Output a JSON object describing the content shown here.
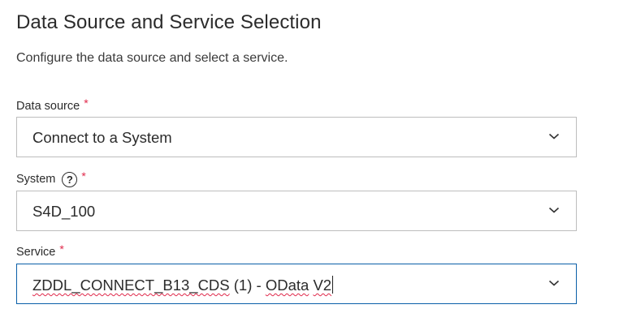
{
  "header": {
    "title": "Data Source and Service Selection",
    "subtitle": "Configure the data source and select a service."
  },
  "fields": {
    "data_source": {
      "label": "Data source",
      "required_marker": "*",
      "value": "Connect to a System"
    },
    "system": {
      "label": "System",
      "help_glyph": "?",
      "required_marker": "*",
      "value": "S4D_100"
    },
    "service": {
      "label": "Service",
      "required_marker": "*",
      "value_parts": [
        "ZDDL_CONNECT_B13_CDS",
        " (1) - ",
        "OData",
        " ",
        "V2"
      ]
    }
  },
  "icons": {
    "dropdown": "chevron-down-icon",
    "help": "help-circle-icon"
  },
  "colors": {
    "required": "#e0284a",
    "focus_border": "#0a5fa8",
    "border": "#bdbdbd"
  }
}
